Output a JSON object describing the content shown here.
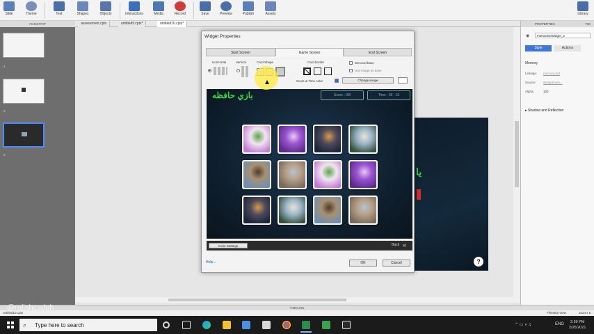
{
  "ribbon": {
    "items": [
      {
        "label": "Slide",
        "icon": "slide-icon"
      },
      {
        "label": "Theme",
        "icon": "theme-icon"
      },
      {
        "label": "Text",
        "icon": "text-icon"
      },
      {
        "label": "Shapes",
        "icon": "shapes-icon"
      },
      {
        "label": "Objects",
        "icon": "objects-icon"
      },
      {
        "label": "Interactions",
        "icon": "interactions-icon"
      },
      {
        "label": "Media",
        "icon": "media-icon"
      },
      {
        "label": "Record",
        "icon": "record-icon"
      },
      {
        "label": "Save",
        "icon": "save-icon"
      },
      {
        "label": "Preview",
        "icon": "preview-icon"
      },
      {
        "label": "Publish",
        "icon": "publish-icon"
      },
      {
        "label": "Assets",
        "icon": "assets-icon"
      },
      {
        "label": "Library",
        "icon": "library-icon"
      }
    ]
  },
  "tabs": {
    "filmstrip_label": "FILMSTRIP",
    "documents": [
      "assessment.cptx",
      "untitled9.cptx*",
      "untitled10.cptx*"
    ]
  },
  "filmstrip": {
    "slides": [
      "1",
      "2",
      "3"
    ]
  },
  "stage": {
    "slide_text": "يا",
    "help_label": "?"
  },
  "timeline": {
    "label": "TIMELINE"
  },
  "status": {
    "file_name": "untitled10.cptx",
    "view": "Filmstrip View",
    "size": "1024 x 6"
  },
  "watermark": "@ralishzadeh",
  "properties": {
    "header": "PROPERTIES",
    "timeline_tab": "TIM",
    "name_value": "InteractiveWidget_3",
    "tabs": {
      "style": "Style",
      "actions": "Actions"
    },
    "section": "Memory",
    "fields": [
      {
        "label": "Linkage:",
        "value": "memory.swf"
      },
      {
        "label": "Source:",
        "value": "Widgetmem..."
      },
      {
        "label": "Alpha:",
        "value": "100"
      }
    ],
    "shadow_label": "Shadow and Reflection"
  },
  "dialog": {
    "title": "Widget Properties",
    "tabs": [
      "Start Screen",
      "Game Screen",
      "End Screen"
    ],
    "options": {
      "horizontal": "Horizontal",
      "vertical": "Vertical",
      "card_shape": "Card Shape",
      "card_border": "Card border",
      "set_card_base": "Set card base",
      "use_image_as_base": "Use image as base",
      "score_time_color": "Score & Time color",
      "change_image": "Change image"
    },
    "preview": {
      "title": "بازي حافظه",
      "score_label": "Score : 0/8",
      "time_label": "Time : 00 : 19",
      "cards": [
        {
          "palette": [
            "#c47ad6",
            "#f0e6ef",
            "#5aa44a"
          ]
        },
        {
          "palette": [
            "#5b2a8a",
            "#9a55d1",
            "#e8c9f2"
          ]
        },
        {
          "palette": [
            "#1b2438",
            "#4e4a5c",
            "#d99a4a"
          ]
        },
        {
          "palette": [
            "#35513a",
            "#9bb6c9",
            "#e9e3d3"
          ]
        },
        {
          "palette": [
            "#6c8fb4",
            "#a89070",
            "#4c3d2f"
          ]
        },
        {
          "palette": [
            "#7a6a59",
            "#b6a089",
            "#b7c3d3"
          ]
        },
        {
          "palette": [
            "#c47ad6",
            "#f0e6ef",
            "#5aa44a"
          ]
        },
        {
          "palette": [
            "#5b2a8a",
            "#9a55d1",
            "#e8c9f2"
          ]
        },
        {
          "palette": [
            "#1b2438",
            "#4e4a5c",
            "#d99a4a"
          ]
        },
        {
          "palette": [
            "#35513a",
            "#9bb6c9",
            "#e9e3d3"
          ]
        },
        {
          "palette": [
            "#6c8fb4",
            "#a89070",
            "#4c3d2f"
          ]
        },
        {
          "palette": [
            "#7a6a59",
            "#b6a089",
            "#b7c3d3"
          ]
        }
      ]
    },
    "color_settings": "Color Settings",
    "back": "Back",
    "back_arrow": "«",
    "help": "Help...",
    "ok": "OK",
    "cancel": "Cancel"
  },
  "taskbar": {
    "search_placeholder": "Type here to search",
    "tray": {
      "lang": "ENG",
      "time": "2:59 PM",
      "date": "2/26/2021"
    }
  },
  "colors": {
    "accent": "#3d77d9",
    "game_title": "#3ed640",
    "highlight": "#ffeb3c"
  }
}
